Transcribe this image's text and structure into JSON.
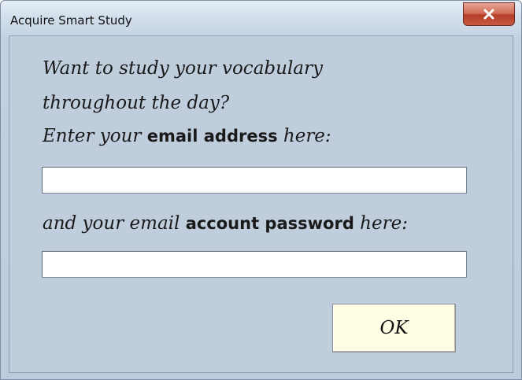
{
  "window": {
    "title": "Acquire Smart Study",
    "close_icon": "close-x-icon"
  },
  "prompt": {
    "line1": "Want to study your vocabulary",
    "line2": "throughout the day?",
    "email_pre": "Enter your ",
    "email_bold": "email address",
    "email_post": " here:",
    "password_pre": "and your email ",
    "password_bold": "account password",
    "password_post": " here:"
  },
  "email_input": {
    "value": ""
  },
  "password_input": {
    "value": ""
  },
  "ok_button": {
    "label": "OK"
  },
  "colors": {
    "dialog_bg": "#bfcddd",
    "close_button": "#c85a43",
    "ok_button_bg": "#fffde3"
  }
}
